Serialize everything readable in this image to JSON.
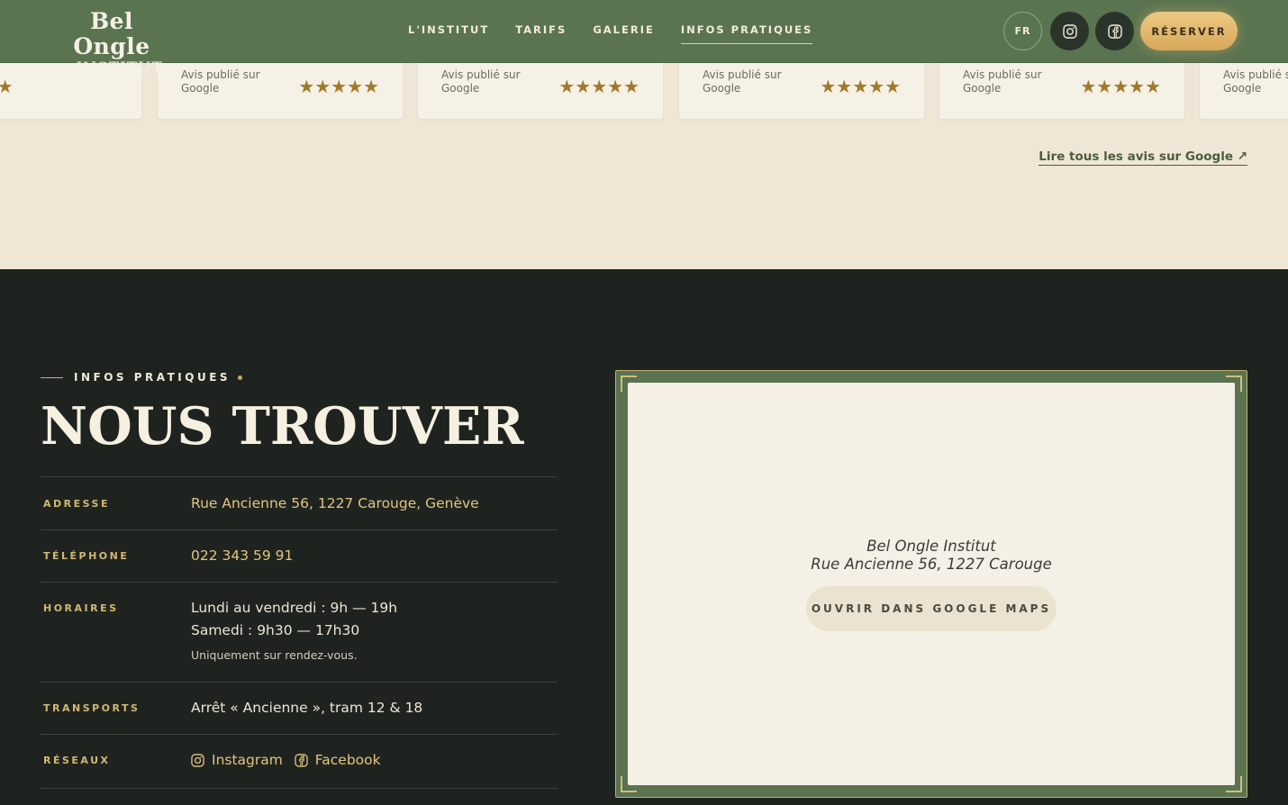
{
  "header": {
    "logo_line1": "Bel Ongle",
    "logo_line2": "• INSTITUT •",
    "nav": [
      "L'INSTITUT",
      "TARIFS",
      "GALERIE",
      "INFOS PRATIQUES"
    ],
    "active_nav": "INFOS PRATIQUES",
    "lang": "FR",
    "reserve_label": "RÉSERVER"
  },
  "reviews": {
    "cards": [
      {
        "source": "",
        "stars": "★★★★★"
      },
      {
        "source": "Avis publié sur Google",
        "stars": "★★★★★"
      },
      {
        "source": "Avis publié sur Google",
        "stars": "★★★★★"
      },
      {
        "source": "Avis publié sur Google",
        "stars": "★★★★★"
      },
      {
        "source": "Avis publié sur Google",
        "stars": "★★★★★"
      },
      {
        "source": "Avis publié sur Google",
        "stars": ""
      }
    ],
    "read_all": "Lire tous les avis sur Google ↗"
  },
  "info": {
    "eyebrow": "INFOS PRATIQUES",
    "title": "NOUS TROUVER",
    "address_label": "ADRESSE",
    "address": "Rue Ancienne 56, 1227 Carouge, Genève",
    "phone_label": "TÉLÉPHONE",
    "phone": "022 343 59 91",
    "hours_label": "HORAIRES",
    "hours_line1": "Lundi au vendredi : 9h — 19h",
    "hours_line2": "Samedi : 9h30 — 17h30",
    "hours_note": "Uniquement sur rendez-vous.",
    "transport_label": "TRANSPORTS",
    "transport": "Arrêt « Ancienne », tram 12 & 18",
    "networks_label": "RÉSEAUX",
    "instagram": "Instagram",
    "facebook": "Facebook"
  },
  "map": {
    "name": "Bel Ongle Institut",
    "address": "Rue Ancienne 56, 1227 Carouge",
    "button": "OUVRIR DANS GOOGLE MAPS"
  },
  "colors": {
    "header_green": "#5a7350",
    "dark_bg": "#1f2320",
    "gold": "#d1b871",
    "cream": "#efe6d6"
  }
}
